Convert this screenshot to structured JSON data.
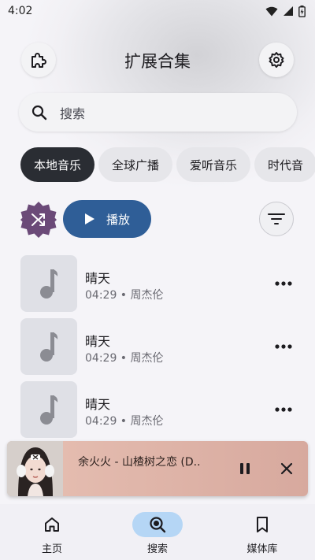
{
  "status_bar": {
    "time": "4:02"
  },
  "header": {
    "title": "扩展合集"
  },
  "search": {
    "placeholder": "搜索"
  },
  "tabs": [
    {
      "label": "本地音乐",
      "active": true
    },
    {
      "label": "全球广播",
      "active": false
    },
    {
      "label": "爱听音乐",
      "active": false
    },
    {
      "label": "时代音",
      "active": false
    }
  ],
  "actions": {
    "play_label": "播放"
  },
  "songs": [
    {
      "title": "晴天",
      "meta": "04:29 • 周杰伦"
    },
    {
      "title": "晴天",
      "meta": "04:29 • 周杰伦"
    },
    {
      "title": "晴天",
      "meta": "04:29 • 周杰伦"
    }
  ],
  "mini_player": {
    "title": "余火火 - 山楂树之恋 (D..",
    "state": "playing"
  },
  "bottom_nav": [
    {
      "label": "主页",
      "icon": "home-icon",
      "active": false
    },
    {
      "label": "搜索",
      "icon": "search-icon",
      "active": true
    },
    {
      "label": "媒体库",
      "icon": "bookmark-icon",
      "active": false
    }
  ],
  "colors": {
    "accent": "#2f5e97",
    "shuffle": "#6b4a78",
    "active_tab": "#2a2d33",
    "nav_active": "#b5d6f5",
    "mini_player": "#dcb0a4"
  }
}
